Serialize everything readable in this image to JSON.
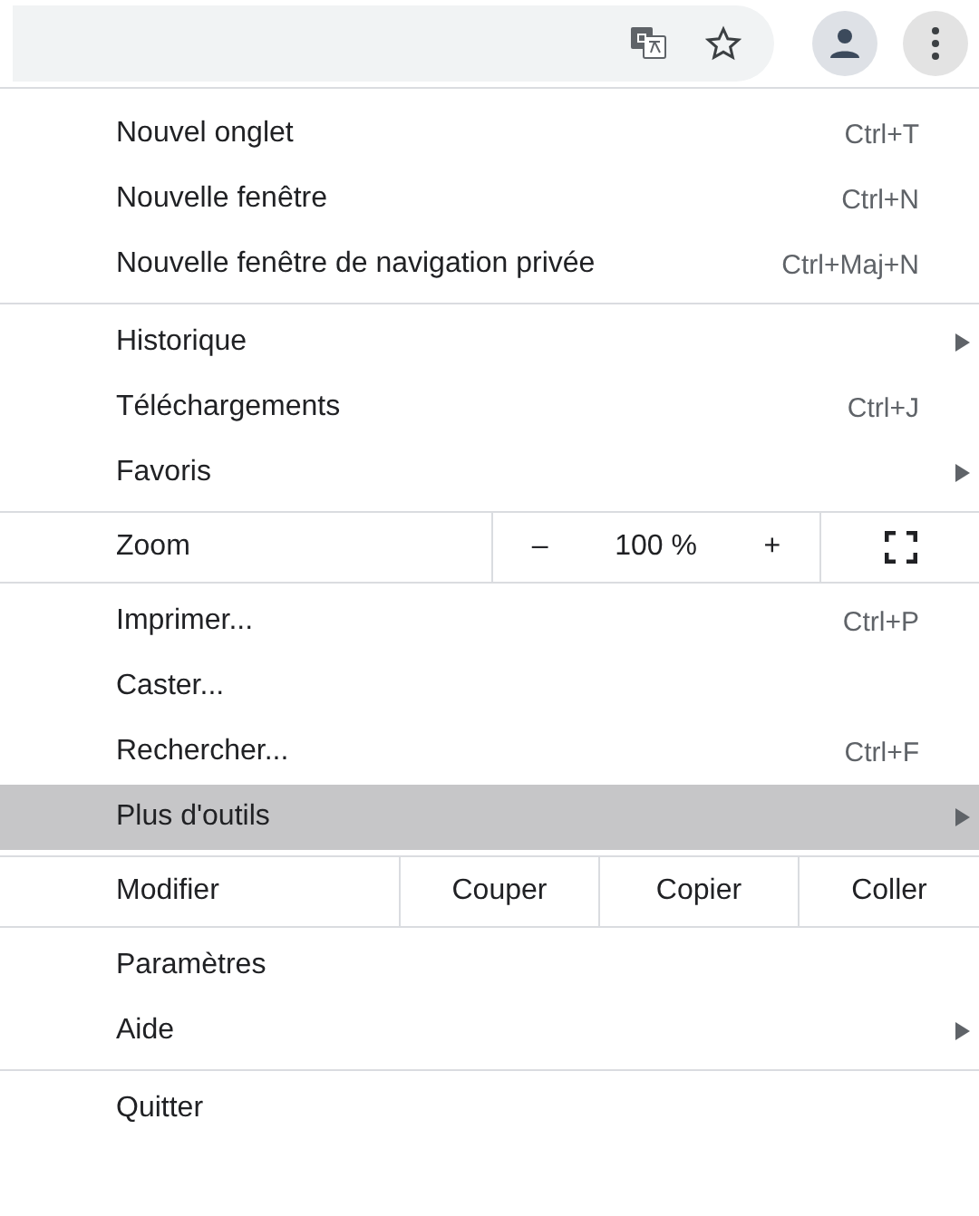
{
  "toolbar": {
    "menu_open": true
  },
  "sections": [
    {
      "items": [
        {
          "kind": "item",
          "label": "Nouvel onglet",
          "shortcut": "Ctrl+T",
          "submenu": false,
          "selected": false
        },
        {
          "kind": "item",
          "label": "Nouvelle fenêtre",
          "shortcut": "Ctrl+N",
          "submenu": false,
          "selected": false
        },
        {
          "kind": "item",
          "label": "Nouvelle fenêtre de navigation privée",
          "shortcut": "Ctrl+Maj+N",
          "submenu": false,
          "selected": false
        }
      ]
    },
    {
      "items": [
        {
          "kind": "item",
          "label": "Historique",
          "submenu": true,
          "selected": false
        },
        {
          "kind": "item",
          "label": "Téléchargements",
          "shortcut": "Ctrl+J",
          "submenu": false,
          "selected": false
        },
        {
          "kind": "item",
          "label": "Favoris",
          "submenu": true,
          "selected": false
        }
      ]
    },
    {
      "items": [
        {
          "kind": "zoom",
          "label": "Zoom",
          "minus": "–",
          "value": "100 %",
          "plus": "+"
        }
      ]
    },
    {
      "items": [
        {
          "kind": "item",
          "label": "Imprimer...",
          "shortcut": "Ctrl+P",
          "submenu": false,
          "selected": false
        },
        {
          "kind": "item",
          "label": "Caster...",
          "submenu": false,
          "selected": false
        },
        {
          "kind": "item",
          "label": "Rechercher...",
          "shortcut": "Ctrl+F",
          "submenu": false,
          "selected": false
        },
        {
          "kind": "item",
          "label": "Plus d'outils",
          "submenu": true,
          "selected": true
        }
      ]
    },
    {
      "items": [
        {
          "kind": "edit",
          "label": "Modifier",
          "buttons": [
            "Couper",
            "Copier",
            "Coller"
          ]
        }
      ]
    },
    {
      "items": [
        {
          "kind": "item",
          "label": "Paramètres",
          "submenu": false,
          "selected": false
        },
        {
          "kind": "item",
          "label": "Aide",
          "submenu": true,
          "selected": false
        }
      ]
    },
    {
      "items": [
        {
          "kind": "item",
          "label": "Quitter",
          "submenu": false,
          "selected": false
        }
      ]
    }
  ]
}
